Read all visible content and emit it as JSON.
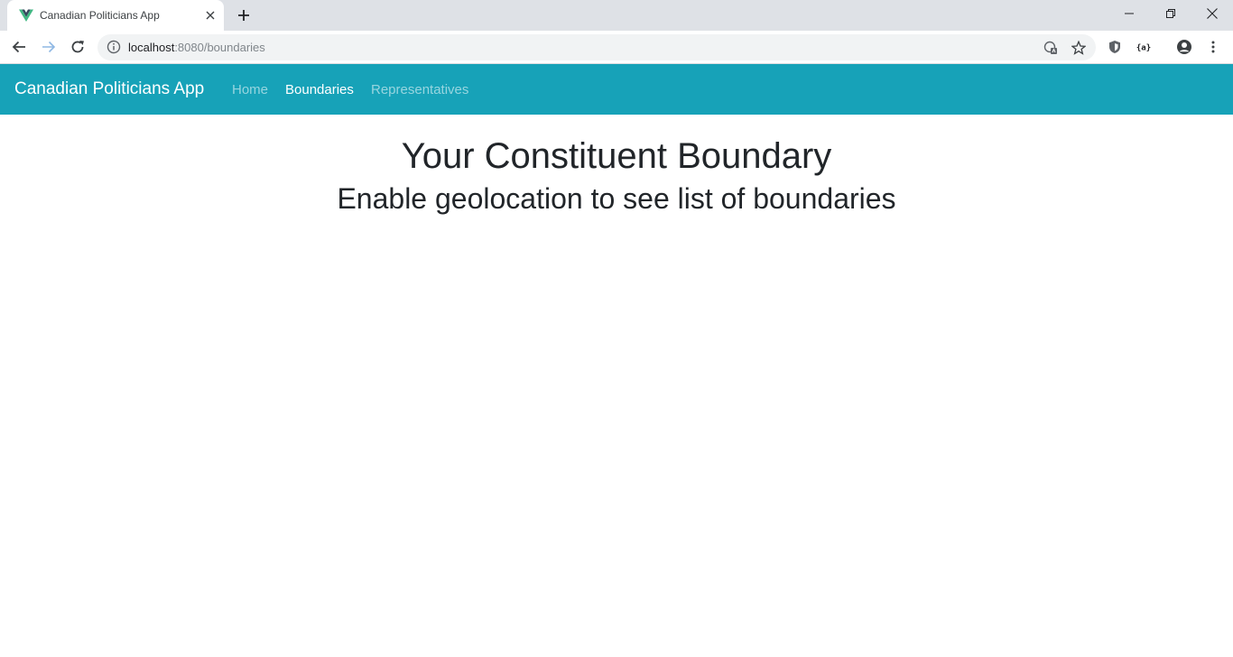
{
  "browser": {
    "tab": {
      "title": "Canadian Politicians App",
      "favicon": "vue-logo-icon"
    },
    "url": {
      "host": "localhost",
      "rest": ":8080/boundaries"
    },
    "icons": {
      "back": "back-arrow-icon",
      "forward": "forward-arrow-icon",
      "reload": "reload-icon",
      "info": "info-icon",
      "translate": "translate-icon",
      "bookmark": "star-icon",
      "extension_shield": "shield-icon",
      "extension_json": "json-icon",
      "profile": "profile-icon",
      "menu": "more-vert-icon"
    }
  },
  "navbar": {
    "brand": "Canadian Politicians App",
    "links": [
      {
        "label": "Home",
        "active": false
      },
      {
        "label": "Boundaries",
        "active": true
      },
      {
        "label": "Representatives",
        "active": false
      }
    ],
    "background": "#17a2b8"
  },
  "main": {
    "title": "Your Constituent Boundary",
    "subtitle": "Enable geolocation to see list of boundaries"
  }
}
